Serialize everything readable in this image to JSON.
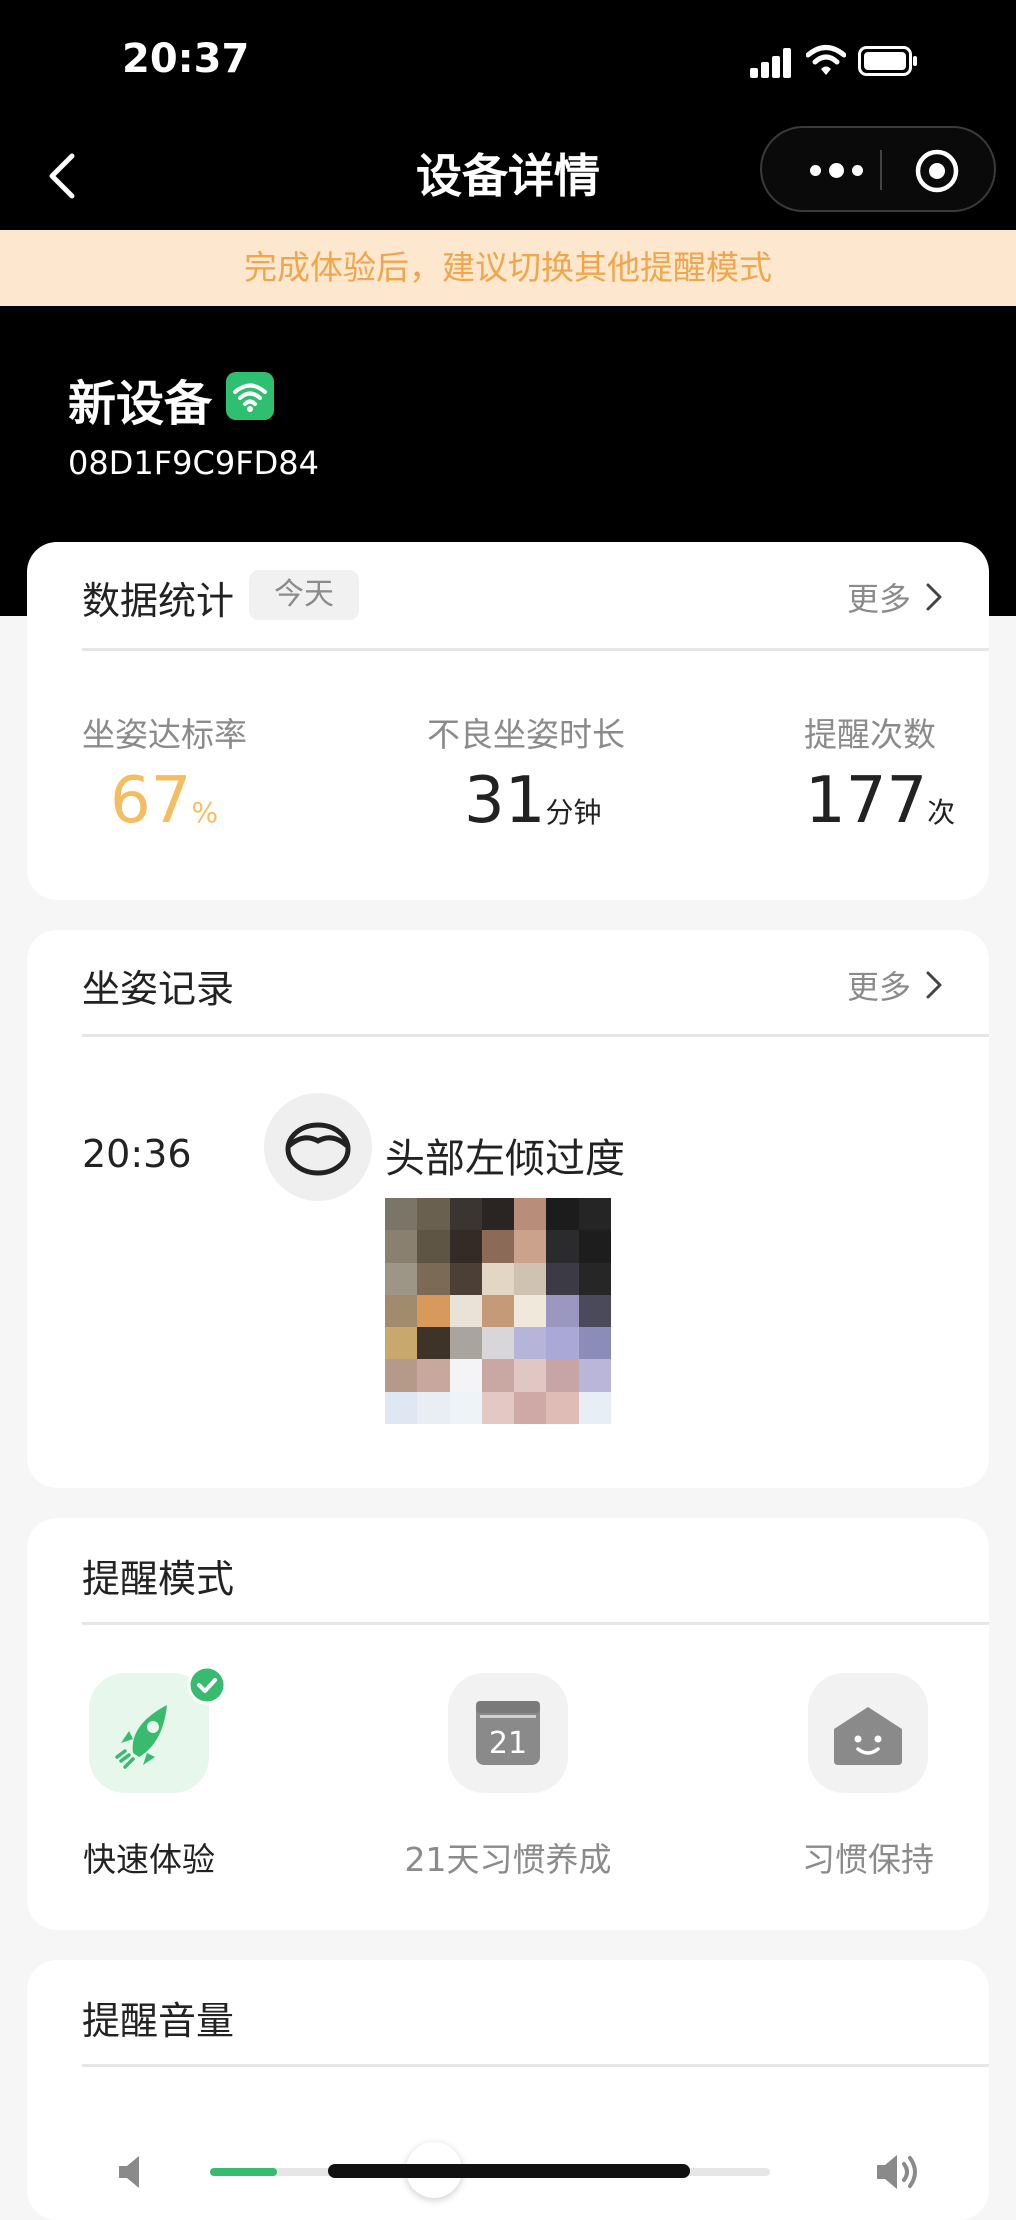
{
  "status_bar": {
    "time": "20:37"
  },
  "nav": {
    "title": "设备详情"
  },
  "banner": {
    "text": "完成体验后，建议切换其他提醒模式"
  },
  "device": {
    "name": "新设备",
    "id": "08D1F9C9FD84",
    "wifi_color": "#2fbf71"
  },
  "stats_card": {
    "title": "数据统计",
    "tag": "今天",
    "more": "更多",
    "items": [
      {
        "label": "坐姿达标率",
        "value": "67",
        "unit": "%"
      },
      {
        "label": "不良坐姿时长",
        "value": "31",
        "unit": "分钟"
      },
      {
        "label": "提醒次数",
        "value": "177",
        "unit": "次"
      }
    ]
  },
  "record_card": {
    "title": "坐姿记录",
    "more": "更多",
    "entries": [
      {
        "time": "20:36",
        "text": "头部左倾过度"
      }
    ]
  },
  "mode_card": {
    "title": "提醒模式",
    "modes": [
      {
        "label": "快速体验",
        "icon": "rocket-icon",
        "selected": true
      },
      {
        "label": "21天习惯养成",
        "icon": "calendar-icon",
        "calendar_number": "21",
        "selected": false
      },
      {
        "label": "习惯保持",
        "icon": "house-smile-icon",
        "selected": false
      }
    ]
  },
  "volume_card": {
    "title": "提醒音量",
    "level": 0.4
  },
  "colors": {
    "accent": "#38bb6e",
    "highlight": "#f5bd62",
    "banner_bg": "#fde7cf",
    "banner_text": "#f0a64a"
  }
}
